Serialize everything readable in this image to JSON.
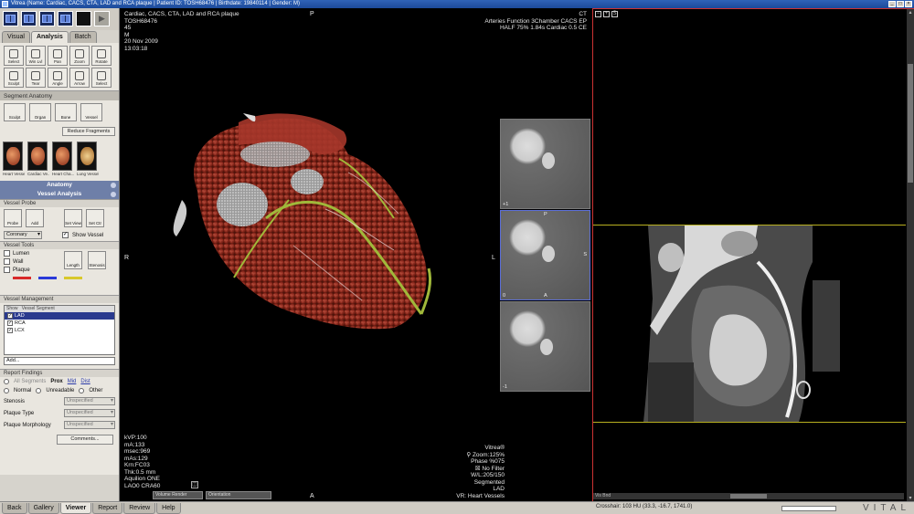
{
  "window": {
    "title": "Vitrea (Name: Cardiac, CACS, CTA, LAD and RCA plaque | Patient ID: TOSH68476 | Birthdate: 19840114 | Gender: M)"
  },
  "tabs": [
    "Visual",
    "Analysis",
    "Batch"
  ],
  "tools": [
    {
      "label": "Select",
      "icon": "pointer-icon"
    },
    {
      "label": "Win Lvl",
      "icon": "window-level-icon"
    },
    {
      "label": "Pan",
      "icon": "pan-icon"
    },
    {
      "label": "Zoom",
      "icon": "zoom-icon"
    },
    {
      "label": "Rotate",
      "icon": "rotate-icon"
    },
    {
      "label": "Sculpt",
      "icon": "sculpt-icon"
    },
    {
      "label": "Tear",
      "icon": "tear-icon"
    },
    {
      "label": "Angle",
      "icon": "angle-icon"
    },
    {
      "label": "Arrow",
      "icon": "arrow-icon"
    },
    {
      "label": "Select",
      "icon": "select-icon"
    }
  ],
  "segment_anatomy": {
    "title": "Segment Anatomy",
    "buttons": [
      "Sculpt",
      "Organ",
      "Bone",
      "Vessel"
    ],
    "reduce_label": "Reduce Fragments"
  },
  "thumbnails": [
    {
      "label": "Heart Vesse..."
    },
    {
      "label": "Cardiac Ve..."
    },
    {
      "label": "Heart Cha..."
    },
    {
      "label": "Lung Vessel"
    }
  ],
  "anatomy_header": "Anatomy",
  "vessel_analysis_header": "Vessel Analysis",
  "vessel_probe": {
    "title": "Vessel Probe",
    "buttons": [
      "Probe",
      "Add",
      "Set View",
      "Set Ctr"
    ],
    "select_value": "Coronary",
    "show_vessel": "Show Vessel"
  },
  "vessel_tools": {
    "title": "Vessel Tools",
    "items": [
      {
        "label": "Lumen"
      },
      {
        "label": "Wall"
      },
      {
        "label": "Plaque"
      }
    ],
    "swatches": [
      "#d82a2a",
      "#2a3ad8",
      "#d8c82a"
    ],
    "buttons": [
      "Length",
      "Stenosis"
    ]
  },
  "vessel_management": {
    "title": "Vessel Management",
    "header_show": "Show",
    "header_segment": "Vessel Segment",
    "vessels": [
      {
        "name": "LAD",
        "selected": true
      },
      {
        "name": "RCA",
        "selected": false
      },
      {
        "name": "LCX",
        "selected": false
      }
    ],
    "add_placeholder": "Add..."
  },
  "report_findings": {
    "title": "Report Findings",
    "all_segments": "All Segments",
    "prox": "Prox",
    "mid": "Mid",
    "dist": "Dist",
    "normal": "Normal",
    "unreadable": "Unreadable",
    "other": "Other",
    "fields": [
      {
        "label": "Stenosis",
        "value": "Unspecified"
      },
      {
        "label": "Plaque Type",
        "value": "Unspecified"
      },
      {
        "label": "Plaque Morphology",
        "value": "Unspecified"
      }
    ],
    "comments_label": "Comments..."
  },
  "viewport3d": {
    "top_left": "Cardiac, CACS, CTA, LAD and RCA plaque\nTOSH68476\n45\nM\n20 Nov 2009\n13:03:18",
    "top_right": "CT\nArteries Function 3Chamber CACS EP\nHALF 75% 1.84s Cardiac 0.5 CE",
    "bottom_left": "kVP:100\nmA:133\nmsec:969\nmAs:129\nKrn:FC03\nThk:0.5 mm\nAquilion ONE\nLAO0 CRA60",
    "bottom_right": "Vitrea®\n⚲ Zoom:125%\nPhase %075\n☒ No Filter\nW/L:205/150\nSegmented\nLAD\nVR: Heart Vessels",
    "orient_top": "P",
    "orient_bottom": "A",
    "orient_right": "R",
    "orient_left": "L",
    "render_select": "Volume Render",
    "orientation_select": "Orientation"
  },
  "slice_stack": [
    {
      "num": "+1",
      "selected": false
    },
    {
      "num": "0",
      "selected": true,
      "top_letter": "P",
      "side_letter": "S",
      "bottom_letter": "A"
    },
    {
      "num": "-1",
      "selected": false
    }
  ],
  "cpr_view": {
    "icons": [
      "minus-icon",
      "plus-icon",
      "settings-icon"
    ],
    "scroll_label": "Vis Bnd"
  },
  "status": {
    "crosshair": "Crosshair: 103 HU (33.3, -16.7, 1741.0)"
  },
  "bottom_nav": [
    "Back",
    "Gallery",
    "Viewer",
    "Report",
    "Review",
    "Help"
  ],
  "brand": "VITAL"
}
